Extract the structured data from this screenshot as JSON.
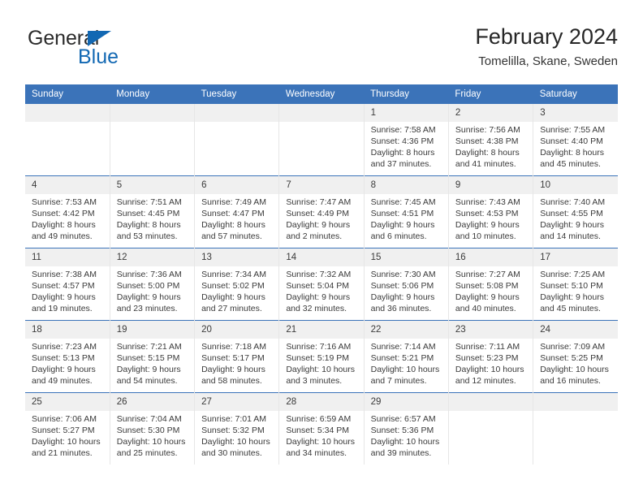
{
  "brand": {
    "name_part1": "General",
    "name_part2": "Blue",
    "triangle_color": "#1268b3"
  },
  "header": {
    "title": "February 2024",
    "subtitle": "Tomelilla, Skane, Sweden",
    "accent_color": "#3b73b9"
  },
  "weekdays": [
    "Sunday",
    "Monday",
    "Tuesday",
    "Wednesday",
    "Thursday",
    "Friday",
    "Saturday"
  ],
  "weeks": [
    [
      {
        "day": "",
        "empty": true,
        "sunrise": "",
        "sunset": "",
        "daylight1": "",
        "daylight2": ""
      },
      {
        "day": "",
        "empty": true,
        "sunrise": "",
        "sunset": "",
        "daylight1": "",
        "daylight2": ""
      },
      {
        "day": "",
        "empty": true,
        "sunrise": "",
        "sunset": "",
        "daylight1": "",
        "daylight2": ""
      },
      {
        "day": "",
        "empty": true,
        "sunrise": "",
        "sunset": "",
        "daylight1": "",
        "daylight2": ""
      },
      {
        "day": "1",
        "sunrise": "Sunrise: 7:58 AM",
        "sunset": "Sunset: 4:36 PM",
        "daylight1": "Daylight: 8 hours",
        "daylight2": "and 37 minutes."
      },
      {
        "day": "2",
        "sunrise": "Sunrise: 7:56 AM",
        "sunset": "Sunset: 4:38 PM",
        "daylight1": "Daylight: 8 hours",
        "daylight2": "and 41 minutes."
      },
      {
        "day": "3",
        "sunrise": "Sunrise: 7:55 AM",
        "sunset": "Sunset: 4:40 PM",
        "daylight1": "Daylight: 8 hours",
        "daylight2": "and 45 minutes."
      }
    ],
    [
      {
        "day": "4",
        "sunrise": "Sunrise: 7:53 AM",
        "sunset": "Sunset: 4:42 PM",
        "daylight1": "Daylight: 8 hours",
        "daylight2": "and 49 minutes."
      },
      {
        "day": "5",
        "sunrise": "Sunrise: 7:51 AM",
        "sunset": "Sunset: 4:45 PM",
        "daylight1": "Daylight: 8 hours",
        "daylight2": "and 53 minutes."
      },
      {
        "day": "6",
        "sunrise": "Sunrise: 7:49 AM",
        "sunset": "Sunset: 4:47 PM",
        "daylight1": "Daylight: 8 hours",
        "daylight2": "and 57 minutes."
      },
      {
        "day": "7",
        "sunrise": "Sunrise: 7:47 AM",
        "sunset": "Sunset: 4:49 PM",
        "daylight1": "Daylight: 9 hours",
        "daylight2": "and 2 minutes."
      },
      {
        "day": "8",
        "sunrise": "Sunrise: 7:45 AM",
        "sunset": "Sunset: 4:51 PM",
        "daylight1": "Daylight: 9 hours",
        "daylight2": "and 6 minutes."
      },
      {
        "day": "9",
        "sunrise": "Sunrise: 7:43 AM",
        "sunset": "Sunset: 4:53 PM",
        "daylight1": "Daylight: 9 hours",
        "daylight2": "and 10 minutes."
      },
      {
        "day": "10",
        "sunrise": "Sunrise: 7:40 AM",
        "sunset": "Sunset: 4:55 PM",
        "daylight1": "Daylight: 9 hours",
        "daylight2": "and 14 minutes."
      }
    ],
    [
      {
        "day": "11",
        "sunrise": "Sunrise: 7:38 AM",
        "sunset": "Sunset: 4:57 PM",
        "daylight1": "Daylight: 9 hours",
        "daylight2": "and 19 minutes."
      },
      {
        "day": "12",
        "sunrise": "Sunrise: 7:36 AM",
        "sunset": "Sunset: 5:00 PM",
        "daylight1": "Daylight: 9 hours",
        "daylight2": "and 23 minutes."
      },
      {
        "day": "13",
        "sunrise": "Sunrise: 7:34 AM",
        "sunset": "Sunset: 5:02 PM",
        "daylight1": "Daylight: 9 hours",
        "daylight2": "and 27 minutes."
      },
      {
        "day": "14",
        "sunrise": "Sunrise: 7:32 AM",
        "sunset": "Sunset: 5:04 PM",
        "daylight1": "Daylight: 9 hours",
        "daylight2": "and 32 minutes."
      },
      {
        "day": "15",
        "sunrise": "Sunrise: 7:30 AM",
        "sunset": "Sunset: 5:06 PM",
        "daylight1": "Daylight: 9 hours",
        "daylight2": "and 36 minutes."
      },
      {
        "day": "16",
        "sunrise": "Sunrise: 7:27 AM",
        "sunset": "Sunset: 5:08 PM",
        "daylight1": "Daylight: 9 hours",
        "daylight2": "and 40 minutes."
      },
      {
        "day": "17",
        "sunrise": "Sunrise: 7:25 AM",
        "sunset": "Sunset: 5:10 PM",
        "daylight1": "Daylight: 9 hours",
        "daylight2": "and 45 minutes."
      }
    ],
    [
      {
        "day": "18",
        "sunrise": "Sunrise: 7:23 AM",
        "sunset": "Sunset: 5:13 PM",
        "daylight1": "Daylight: 9 hours",
        "daylight2": "and 49 minutes."
      },
      {
        "day": "19",
        "sunrise": "Sunrise: 7:21 AM",
        "sunset": "Sunset: 5:15 PM",
        "daylight1": "Daylight: 9 hours",
        "daylight2": "and 54 minutes."
      },
      {
        "day": "20",
        "sunrise": "Sunrise: 7:18 AM",
        "sunset": "Sunset: 5:17 PM",
        "daylight1": "Daylight: 9 hours",
        "daylight2": "and 58 minutes."
      },
      {
        "day": "21",
        "sunrise": "Sunrise: 7:16 AM",
        "sunset": "Sunset: 5:19 PM",
        "daylight1": "Daylight: 10 hours",
        "daylight2": "and 3 minutes."
      },
      {
        "day": "22",
        "sunrise": "Sunrise: 7:14 AM",
        "sunset": "Sunset: 5:21 PM",
        "daylight1": "Daylight: 10 hours",
        "daylight2": "and 7 minutes."
      },
      {
        "day": "23",
        "sunrise": "Sunrise: 7:11 AM",
        "sunset": "Sunset: 5:23 PM",
        "daylight1": "Daylight: 10 hours",
        "daylight2": "and 12 minutes."
      },
      {
        "day": "24",
        "sunrise": "Sunrise: 7:09 AM",
        "sunset": "Sunset: 5:25 PM",
        "daylight1": "Daylight: 10 hours",
        "daylight2": "and 16 minutes."
      }
    ],
    [
      {
        "day": "25",
        "sunrise": "Sunrise: 7:06 AM",
        "sunset": "Sunset: 5:27 PM",
        "daylight1": "Daylight: 10 hours",
        "daylight2": "and 21 minutes."
      },
      {
        "day": "26",
        "sunrise": "Sunrise: 7:04 AM",
        "sunset": "Sunset: 5:30 PM",
        "daylight1": "Daylight: 10 hours",
        "daylight2": "and 25 minutes."
      },
      {
        "day": "27",
        "sunrise": "Sunrise: 7:01 AM",
        "sunset": "Sunset: 5:32 PM",
        "daylight1": "Daylight: 10 hours",
        "daylight2": "and 30 minutes."
      },
      {
        "day": "28",
        "sunrise": "Sunrise: 6:59 AM",
        "sunset": "Sunset: 5:34 PM",
        "daylight1": "Daylight: 10 hours",
        "daylight2": "and 34 minutes."
      },
      {
        "day": "29",
        "sunrise": "Sunrise: 6:57 AM",
        "sunset": "Sunset: 5:36 PM",
        "daylight1": "Daylight: 10 hours",
        "daylight2": "and 39 minutes."
      },
      {
        "day": "",
        "empty": true,
        "sunrise": "",
        "sunset": "",
        "daylight1": "",
        "daylight2": ""
      },
      {
        "day": "",
        "empty": true,
        "sunrise": "",
        "sunset": "",
        "daylight1": "",
        "daylight2": ""
      }
    ]
  ]
}
